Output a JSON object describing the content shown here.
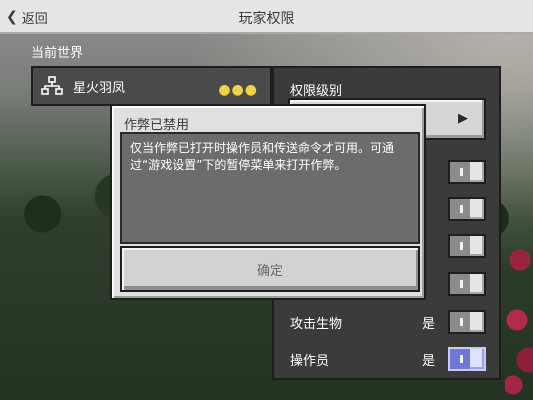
{
  "header": {
    "back_label": "返回",
    "title": "玩家权限"
  },
  "world_section": {
    "label": "当前世界",
    "player": {
      "name": "星火羽凤",
      "icon": "network-icon",
      "more_icon": "more-options-icon"
    }
  },
  "permissions": {
    "title": "权限级别",
    "rows": [
      {
        "label": "",
        "value": "",
        "on": false
      },
      {
        "label": "",
        "value": "",
        "on": false
      },
      {
        "label": "",
        "value": "",
        "on": false
      },
      {
        "label": "",
        "value": "",
        "on": false
      },
      {
        "label": "攻击生物",
        "value": "是",
        "on": false
      },
      {
        "label": "操作员",
        "value": "是",
        "on": true
      }
    ]
  },
  "dialog": {
    "title": "作弊已禁用",
    "message": "仅当作弊已打开时操作员和传送命令才可用。可通过“游戏设置”下的暂停菜单来打开作弊。",
    "confirm_label": "确定"
  },
  "colors": {
    "toggle_on": "#6f78d6",
    "more_dots": "#f0d24a"
  }
}
